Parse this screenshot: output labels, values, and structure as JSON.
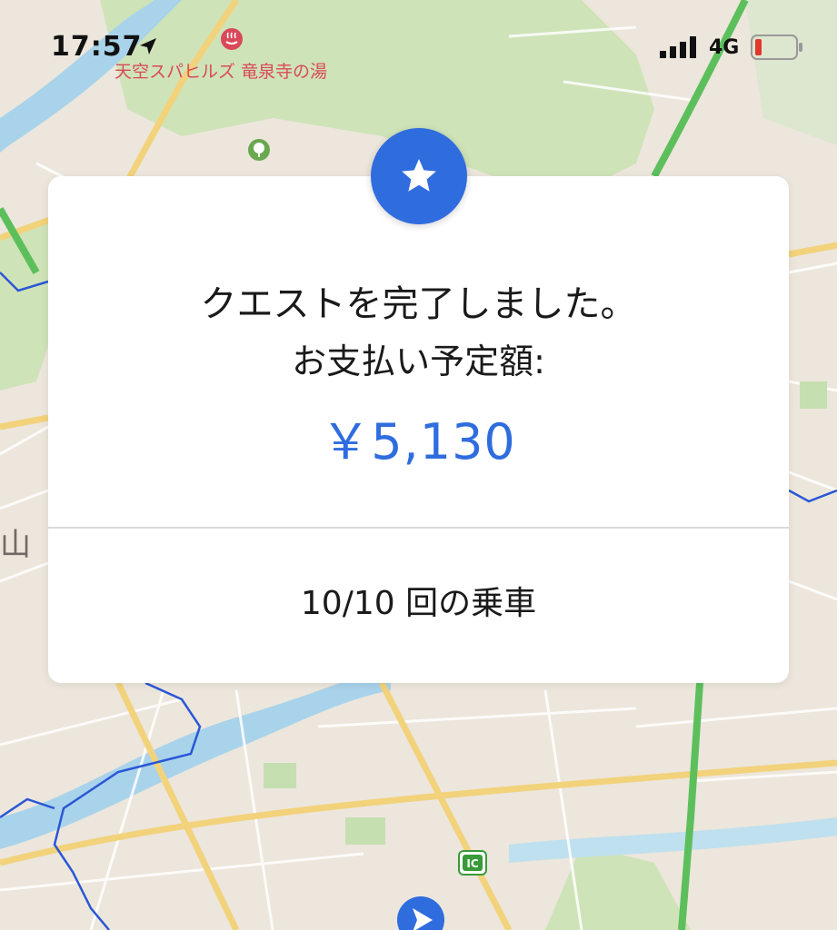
{
  "status_bar": {
    "time": "17:57",
    "network": "4G"
  },
  "map": {
    "poi_onsen": "天空スパヒルズ 竜泉寺の湯",
    "side_label": "山",
    "colors": {
      "land": "#ece6dc",
      "park": "#c9dfb2",
      "water": "#a8d4ea",
      "highway": "#5cbf5c",
      "major_road": "#f4d37e",
      "boundary": "#2a57d6"
    }
  },
  "dialog": {
    "title": "クエストを完了しました。",
    "amount_label": "お支払い予定額:",
    "amount": "￥5,130",
    "rides": "10/10 回の乗車",
    "accent_color": "#2f6ddf",
    "badge_icon": "star-icon"
  }
}
